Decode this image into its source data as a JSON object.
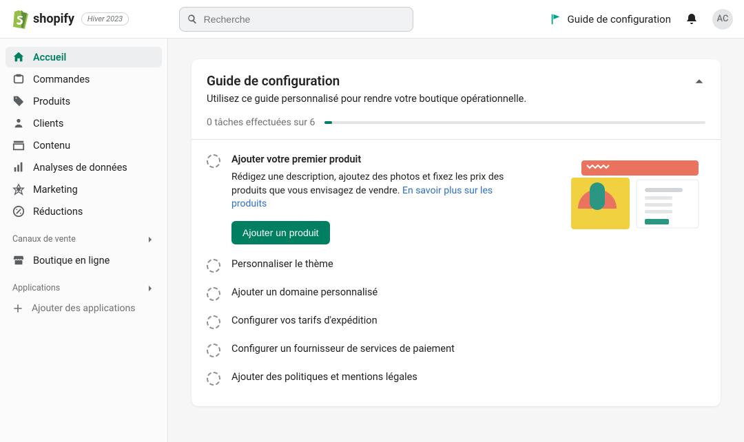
{
  "header": {
    "brand": "shopify",
    "season_badge": "Hiver 2023",
    "search_placeholder": "Recherche",
    "guide_label": "Guide de configuration",
    "avatar_initials": "AC"
  },
  "sidebar": {
    "items": [
      {
        "label": "Accueil",
        "active": true
      },
      {
        "label": "Commandes"
      },
      {
        "label": "Produits"
      },
      {
        "label": "Clients"
      },
      {
        "label": "Contenu"
      },
      {
        "label": "Analyses de données"
      },
      {
        "label": "Marketing"
      },
      {
        "label": "Réductions"
      }
    ],
    "channels_header": "Canaux de vente",
    "channels": [
      {
        "label": "Boutique en ligne"
      }
    ],
    "apps_header": "Applications",
    "add_apps_label": "Ajouter des applications"
  },
  "guide": {
    "title": "Guide de configuration",
    "subtitle": "Utilisez ce guide personnalisé pour rendre votre boutique opérationnelle.",
    "progress_text": "0 tâches effectuées sur 6",
    "steps": [
      {
        "title": "Ajouter votre premier produit",
        "desc": "Rédigez une description, ajoutez des photos et fixez les prix des produits que vous envisagez de vendre. ",
        "link": "En savoir plus sur les produits",
        "button": "Ajouter un produit",
        "expanded": true
      },
      {
        "title": "Personnaliser le thème"
      },
      {
        "title": "Ajouter un domaine personnalisé"
      },
      {
        "title": "Configurer vos tarifs d'expédition"
      },
      {
        "title": "Configurer un fournisseur de services de paiement"
      },
      {
        "title": "Ajouter des politiques et mentions légales"
      }
    ]
  }
}
